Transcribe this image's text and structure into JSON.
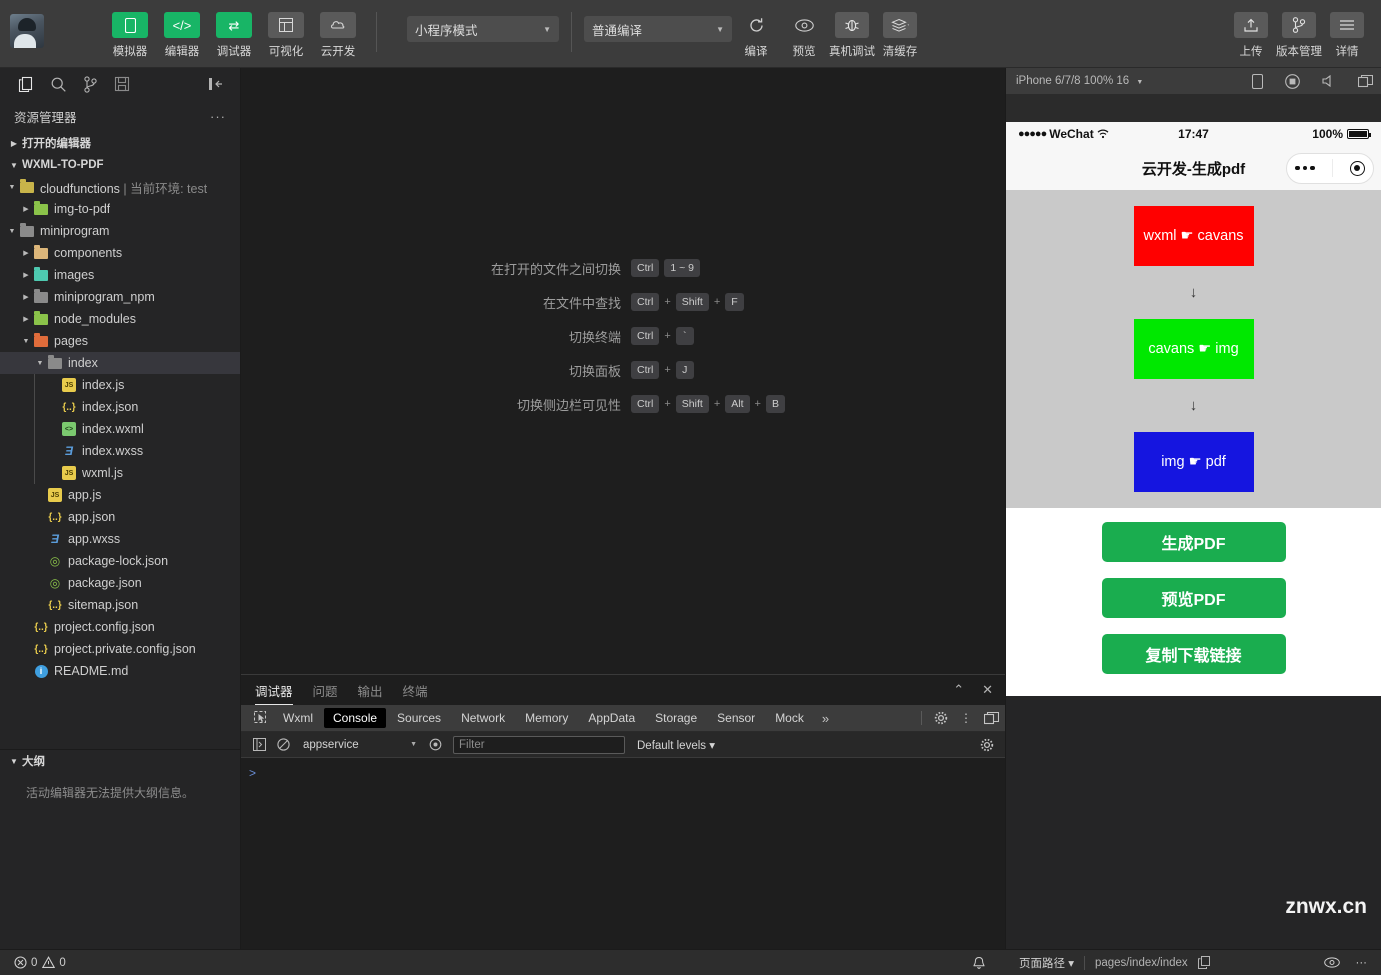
{
  "toolbar": {
    "mode_buttons": [
      {
        "label": "模拟器",
        "icon": "simulator-icon",
        "style": "green"
      },
      {
        "label": "编辑器",
        "icon": "code-icon",
        "style": "green"
      },
      {
        "label": "调试器",
        "icon": "debugger-icon",
        "style": "green"
      },
      {
        "label": "可视化",
        "icon": "visual-icon",
        "style": "grey"
      },
      {
        "label": "云开发",
        "icon": "cloud-icon",
        "style": "grey"
      }
    ],
    "mode_select": "小程序模式",
    "compile_select": "普通编译",
    "actions": [
      {
        "label": "编译",
        "icon": "refresh-icon"
      },
      {
        "label": "预览",
        "icon": "eye-icon"
      },
      {
        "label": "真机调试",
        "icon": "bug-icon"
      },
      {
        "label": "清缓存",
        "icon": "layers-icon"
      }
    ],
    "right_actions": [
      {
        "label": "上传",
        "icon": "upload-icon"
      },
      {
        "label": "版本管理",
        "icon": "branch-icon"
      },
      {
        "label": "详情",
        "icon": "menu-icon"
      }
    ]
  },
  "sidebar": {
    "activity_icons": [
      "files-icon",
      "search-icon",
      "source-control-icon",
      "save-all-icon",
      "collapse-sidebar-icon"
    ],
    "title": "资源管理器",
    "more": "···",
    "open_editors": "打开的编辑器",
    "project": "WXML-TO-PDF",
    "tree": [
      {
        "label": "cloudfunctions",
        "env": " | 当前环境: test",
        "type": "folder",
        "icon": "folder-cloud-icon",
        "indent": 1,
        "twisty": "down",
        "selected": false
      },
      {
        "label": "img-to-pdf",
        "type": "folder",
        "icon": "folder-node-icon",
        "indent": 2,
        "twisty": "right",
        "selected": false
      },
      {
        "label": "miniprogram",
        "type": "folder",
        "icon": "folder-plain-icon",
        "indent": 1,
        "twisty": "down",
        "selected": false
      },
      {
        "label": "components",
        "type": "folder",
        "icon": "folder-components-icon",
        "indent": 2,
        "twisty": "right",
        "selected": false
      },
      {
        "label": "images",
        "type": "folder",
        "icon": "folder-images-icon",
        "indent": 2,
        "twisty": "right",
        "selected": false
      },
      {
        "label": "miniprogram_npm",
        "type": "folder",
        "icon": "folder-plain-icon",
        "indent": 2,
        "twisty": "right",
        "selected": false
      },
      {
        "label": "node_modules",
        "type": "folder",
        "icon": "folder-node-icon",
        "indent": 2,
        "twisty": "right",
        "selected": false
      },
      {
        "label": "pages",
        "type": "folder",
        "icon": "folder-pages-icon",
        "indent": 2,
        "twisty": "down",
        "selected": false
      },
      {
        "label": "index",
        "type": "folder",
        "icon": "folder-plain-icon",
        "indent": 3,
        "twisty": "down",
        "selected": true
      },
      {
        "label": "index.js",
        "type": "file",
        "icon": "js-file-icon",
        "indent": 4,
        "twisty": "",
        "selected": false
      },
      {
        "label": "index.json",
        "type": "file",
        "icon": "json-file-icon",
        "indent": 4,
        "twisty": "",
        "selected": false
      },
      {
        "label": "index.wxml",
        "type": "file",
        "icon": "wxml-file-icon",
        "indent": 4,
        "twisty": "",
        "selected": false
      },
      {
        "label": "index.wxss",
        "type": "file",
        "icon": "wxss-file-icon",
        "indent": 4,
        "twisty": "",
        "selected": false
      },
      {
        "label": "wxml.js",
        "type": "file",
        "icon": "js-file-icon",
        "indent": 4,
        "twisty": "",
        "selected": false
      },
      {
        "label": "app.js",
        "type": "file",
        "icon": "js-file-icon",
        "indent": 3,
        "twisty": "",
        "selected": false
      },
      {
        "label": "app.json",
        "type": "file",
        "icon": "json-file-icon",
        "indent": 3,
        "twisty": "",
        "selected": false
      },
      {
        "label": "app.wxss",
        "type": "file",
        "icon": "wxss-file-icon",
        "indent": 3,
        "twisty": "",
        "selected": false
      },
      {
        "label": "package-lock.json",
        "type": "file",
        "icon": "package-file-icon",
        "indent": 3,
        "twisty": "",
        "selected": false
      },
      {
        "label": "package.json",
        "type": "file",
        "icon": "package-file-icon",
        "indent": 3,
        "twisty": "",
        "selected": false
      },
      {
        "label": "sitemap.json",
        "type": "file",
        "icon": "json-file-icon",
        "indent": 3,
        "twisty": "",
        "selected": false
      },
      {
        "label": "project.config.json",
        "type": "file",
        "icon": "json-file-icon",
        "indent": 2,
        "twisty": "",
        "selected": false
      },
      {
        "label": "project.private.config.json",
        "type": "file",
        "icon": "json-file-icon",
        "indent": 2,
        "twisty": "",
        "selected": false
      },
      {
        "label": "README.md",
        "type": "file",
        "icon": "markdown-file-icon",
        "indent": 2,
        "twisty": "",
        "selected": false
      }
    ],
    "outline_title": "大纲",
    "outline_message": "活动编辑器无法提供大纲信息。"
  },
  "editor": {
    "shortcuts": [
      {
        "label": "在打开的文件之间切换",
        "keys": [
          "Ctrl",
          "1 ~ 9"
        ],
        "separators": [
          ""
        ]
      },
      {
        "label": "在文件中查找",
        "keys": [
          "Ctrl",
          "Shift",
          "F"
        ],
        "separators": [
          "+",
          "+"
        ]
      },
      {
        "label": "切换终端",
        "keys": [
          "Ctrl",
          "`"
        ],
        "separators": [
          "+"
        ]
      },
      {
        "label": "切换面板",
        "keys": [
          "Ctrl",
          "J"
        ],
        "separators": [
          "+"
        ]
      },
      {
        "label": "切换侧边栏可见性",
        "keys": [
          "Ctrl",
          "Shift",
          "Alt",
          "B"
        ],
        "separators": [
          "+",
          "+",
          "+"
        ]
      }
    ]
  },
  "panel": {
    "tabs": [
      {
        "label": "调试器",
        "active": true
      },
      {
        "label": "问题",
        "active": false
      },
      {
        "label": "输出",
        "active": false
      },
      {
        "label": "终端",
        "active": false
      }
    ],
    "actions": [
      "chevron-up-icon",
      "close-icon"
    ],
    "devtools_tabs": [
      {
        "label": "Wxml",
        "active": false
      },
      {
        "label": "Console",
        "active": true
      },
      {
        "label": "Sources",
        "active": false
      },
      {
        "label": "Network",
        "active": false
      },
      {
        "label": "Memory",
        "active": false
      },
      {
        "label": "AppData",
        "active": false
      },
      {
        "label": "Storage",
        "active": false
      },
      {
        "label": "Sensor",
        "active": false
      },
      {
        "label": "Mock",
        "active": false
      }
    ],
    "devtools_more": "»",
    "console": {
      "context": "appservice",
      "filter_placeholder": "Filter",
      "filter_value": "",
      "levels": "Default levels",
      "prompt": ">"
    }
  },
  "simulator": {
    "device": "iPhone 6/7/8 100% 16",
    "top_icons": [
      "rotate-device-icon",
      "record-icon",
      "volume-icon",
      "multi-window-icon"
    ],
    "status": {
      "carrier_dots": "●●●●●",
      "carrier": "WeChat",
      "wifi": "wifi-icon",
      "time": "17:47",
      "battery_percent": "100%"
    },
    "nav_title": "云开发-生成pdf",
    "capsule": {
      "more": "more-dots-icon",
      "target": "target-icon"
    },
    "flow": [
      {
        "label": "wxml ☛ cavans",
        "color": "#FF0000"
      },
      {
        "label": "cavans ☛ img",
        "color": "#00E800"
      },
      {
        "label": "img ☛ pdf",
        "color": "#1515E0"
      }
    ],
    "arrow": "↓",
    "buttons": [
      {
        "label": "生成PDF"
      },
      {
        "label": "预览PDF"
      },
      {
        "label": "复制下载链接"
      }
    ],
    "watermark": "znwx.cn"
  },
  "status_bar": {
    "errors": "0",
    "warnings": "0",
    "bell": "bell-icon",
    "page_path_label": "页面路径",
    "page_path_value": "pages/index/index",
    "copy_icon": "copy-icon",
    "right_icons": [
      "eye-icon",
      "more-icon"
    ]
  }
}
